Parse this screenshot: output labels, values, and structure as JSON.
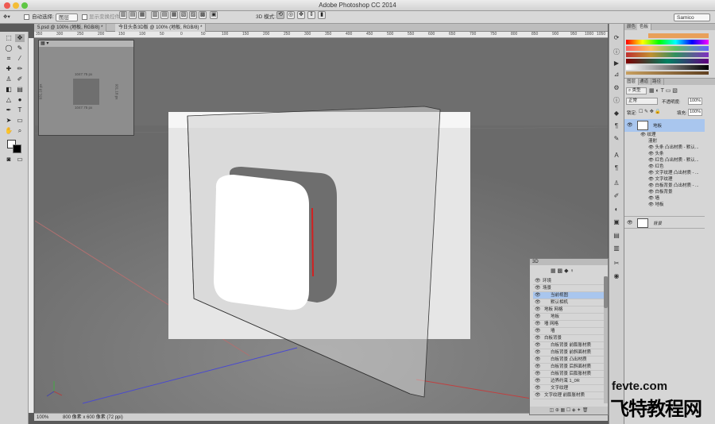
{
  "app_title": "Adobe Photoshop CC 2014",
  "options": {
    "auto_select_label": "自动选择:",
    "auto_select_value": "图层",
    "transform_label": "显示变换控件",
    "mode_label": "3D 模式:",
    "workspace": "Samico"
  },
  "tabs": [
    "5.psd @ 100% (地板, RGB/8) *",
    "今日头条3D版 @ 100% (地板, RGB/8) *"
  ],
  "ruler_ticks": [
    "350",
    "300",
    "250",
    "200",
    "150",
    "100",
    "50",
    "0",
    "50",
    "100",
    "150",
    "200",
    "250",
    "300",
    "350",
    "400",
    "450",
    "500",
    "550",
    "600",
    "650",
    "700",
    "750",
    "800",
    "850",
    "900",
    "950",
    "1000",
    "1050"
  ],
  "navigator": {
    "top": "1047.75 px",
    "bottom": "1047.75 px",
    "left": "931.18 px",
    "right": "931.18 px"
  },
  "status": {
    "zoom": "100%",
    "doc": "800 像素 x 600 像素 (72 ppi)"
  },
  "swatch_tabs": [
    "颜色",
    "色板"
  ],
  "layers": {
    "tabs": [
      "图层",
      "通道",
      "路径"
    ],
    "filter": "类型",
    "blend": "正常",
    "opacity_label": "不透明度:",
    "opacity": "100%",
    "lock_label": "锁定:",
    "fill_label": "填充:",
    "fill": "100%",
    "top_layer": "地板",
    "rows": [
      "纹理",
      "漫射",
      "头条 凸出材质 - 默认...",
      "头条",
      "红色 凸出材质 - 默认...",
      "红色",
      "文字纹理 凸出材质 - ...",
      "文字纹理",
      "白板背景 凸出材质 - ...",
      "白板背景",
      "墙",
      "地板"
    ],
    "bottom_layer": "背景"
  },
  "panel3d": {
    "title": "3D",
    "rows": [
      "环境",
      "场景",
      "当前视图",
      "默认相机",
      "地板 网格",
      "地板",
      "墙 网格",
      "墙",
      "白板背景",
      "白板背景 前膨胀材质",
      "白板背景 前斜面材质",
      "白板背景 凸出材质",
      "白板背景 后斜面材质",
      "白板背景 后膨胀材质",
      "边界约束 1_0R",
      "文字纹理",
      "文字纹理 前膨胀材质"
    ]
  },
  "watermark": {
    "line1": "fevte.com",
    "line2": "飞特教程网"
  },
  "colors": {
    "selected": "#a9c6ee",
    "red": "#d32020",
    "swatch_orange": "#e8a05a"
  }
}
